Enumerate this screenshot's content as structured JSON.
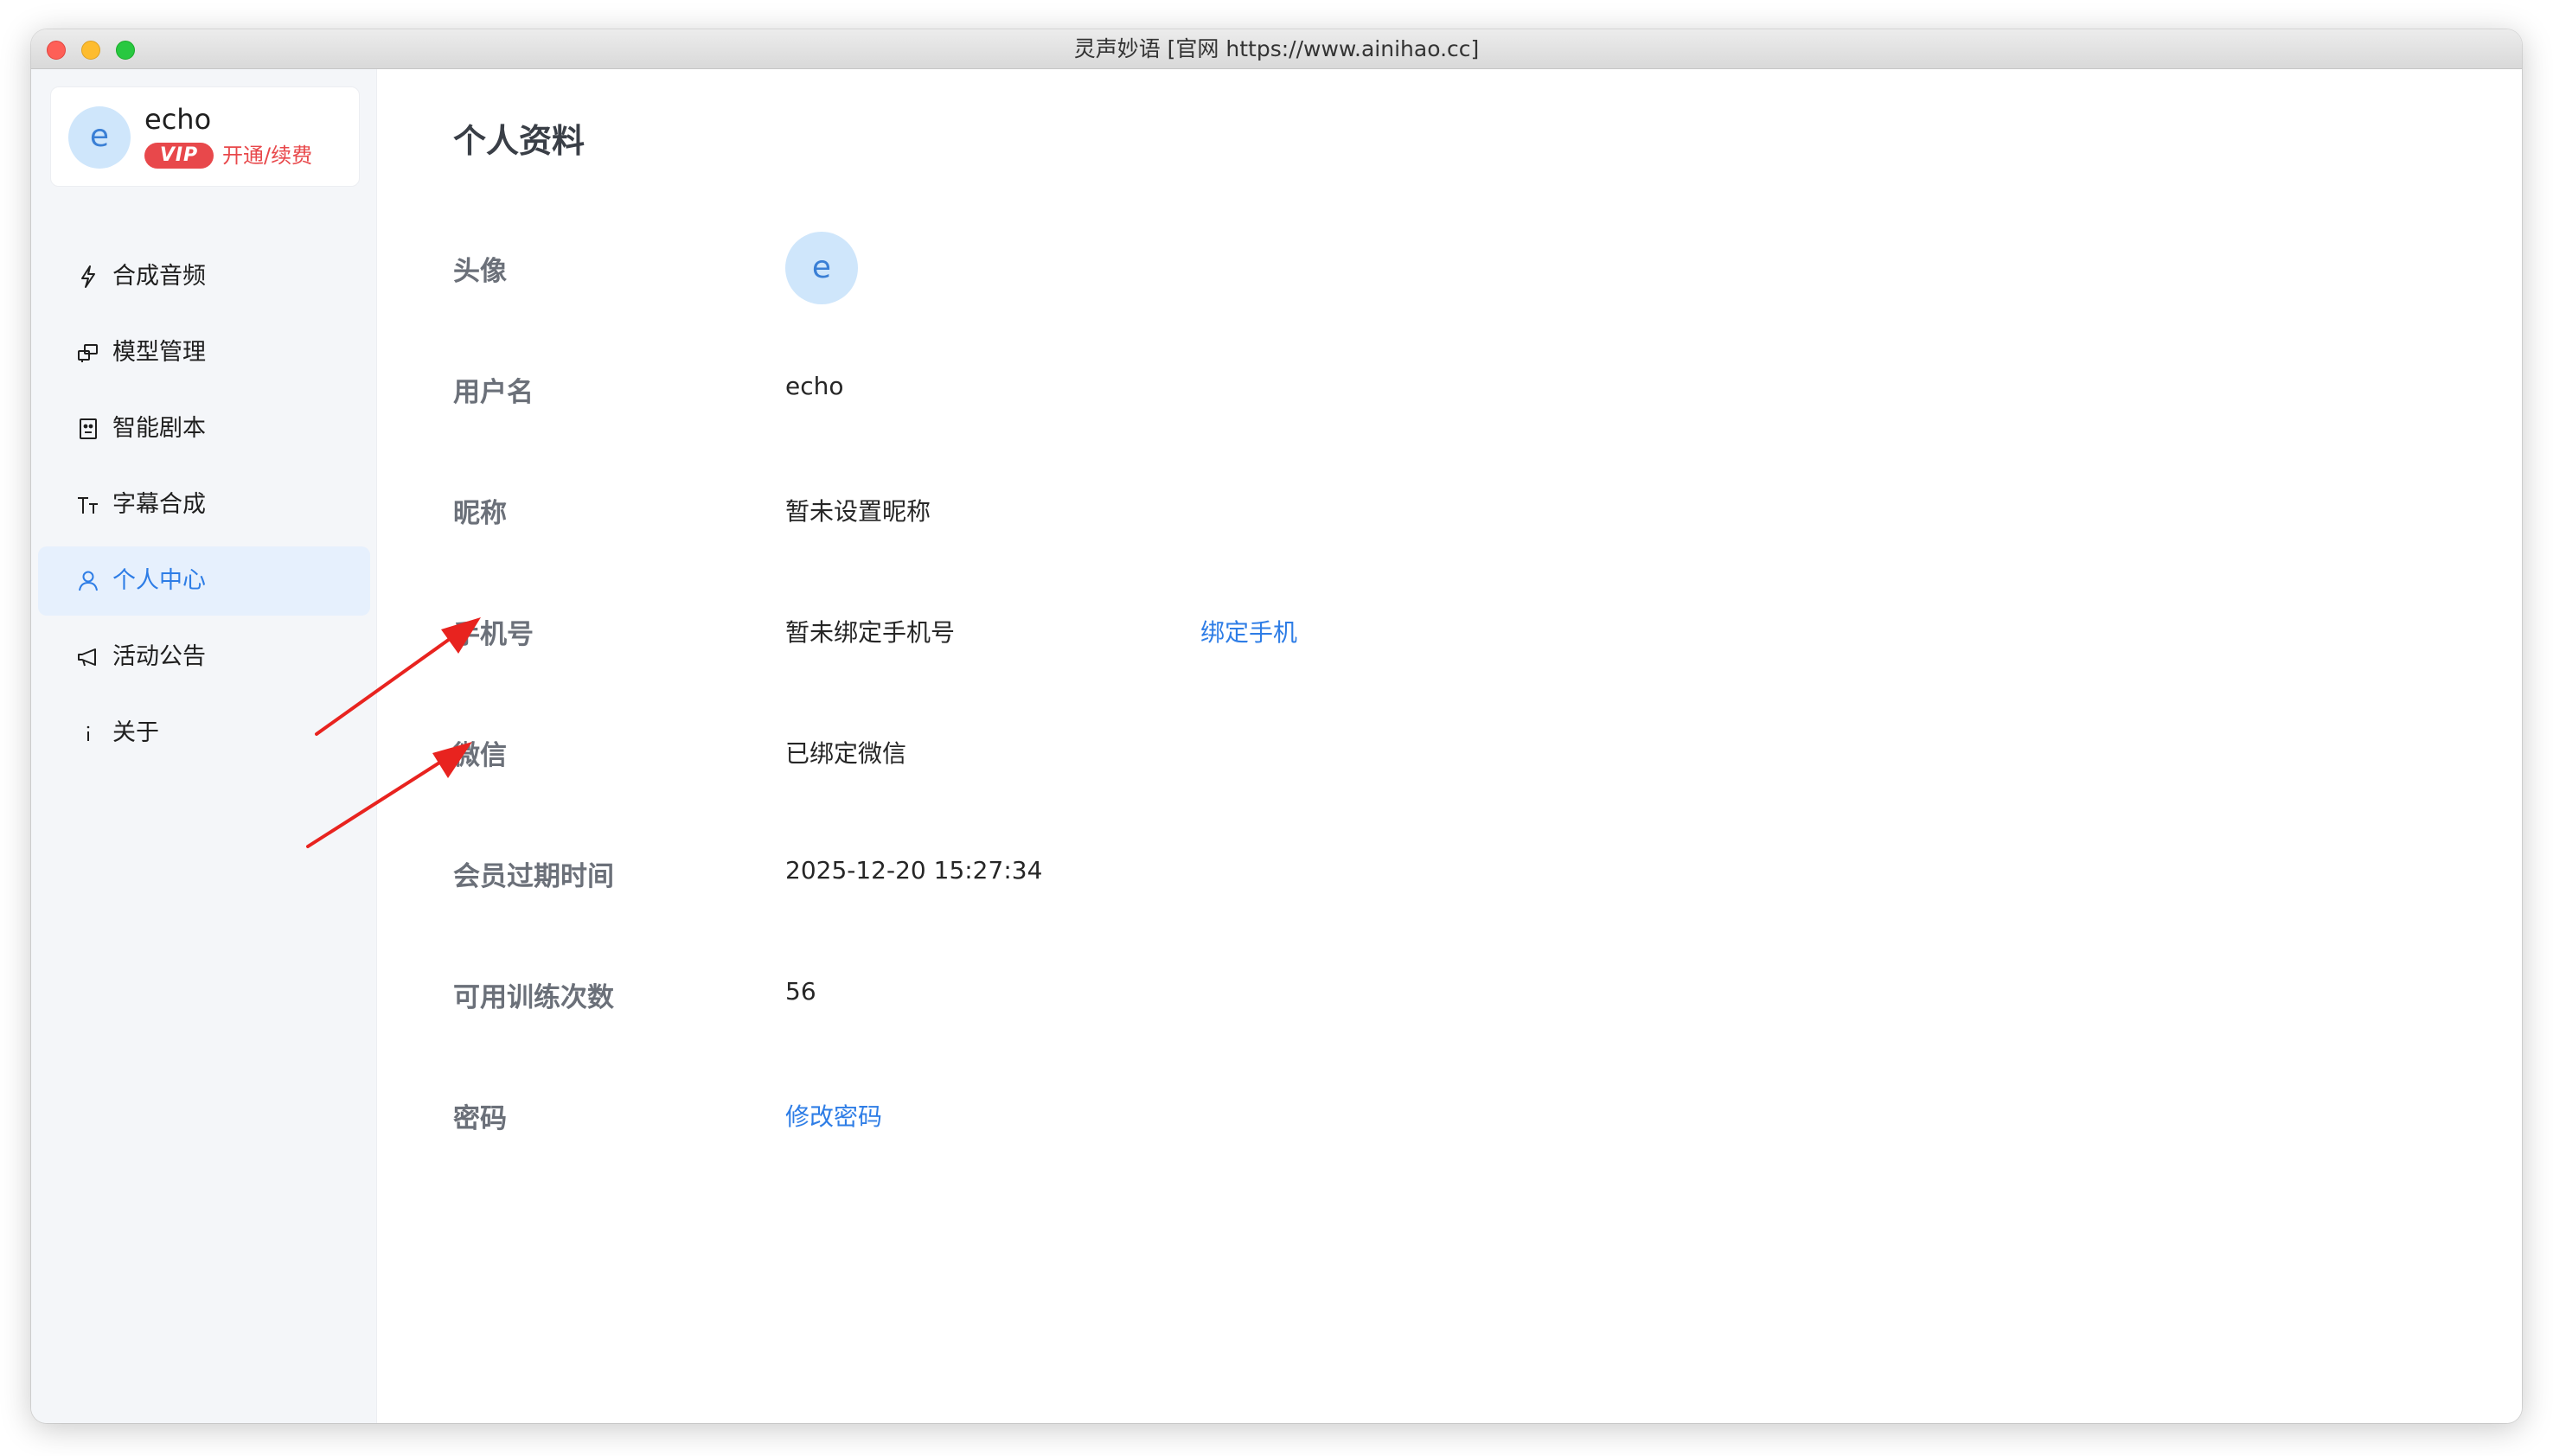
{
  "window": {
    "title": "灵声妙语 [官网 https://www.ainihao.cc]"
  },
  "sidebar": {
    "user": {
      "avatar_letter": "e",
      "username": "echo",
      "vip_label": "VIP",
      "renew_label": "开通/续费"
    },
    "items": [
      {
        "label": "合成音频",
        "icon": "lightning-icon",
        "active": false
      },
      {
        "label": "模型管理",
        "icon": "model-icon",
        "active": false
      },
      {
        "label": "智能剧本",
        "icon": "script-icon",
        "active": false
      },
      {
        "label": "字幕合成",
        "icon": "text-icon",
        "active": false
      },
      {
        "label": "个人中心",
        "icon": "user-icon",
        "active": true
      },
      {
        "label": "活动公告",
        "icon": "megaphone-icon",
        "active": false
      },
      {
        "label": "关于",
        "icon": "info-icon",
        "active": false
      }
    ]
  },
  "profile": {
    "title": "个人资料",
    "avatar": {
      "label": "头像",
      "letter": "e"
    },
    "username": {
      "label": "用户名",
      "value": "echo"
    },
    "nickname": {
      "label": "昵称",
      "value": "暂未设置昵称"
    },
    "phone": {
      "label": "手机号",
      "value": "暂未绑定手机号",
      "action": "绑定手机"
    },
    "wechat": {
      "label": "微信",
      "value": "已绑定微信"
    },
    "membership_expiry": {
      "label": "会员过期时间",
      "value": "2025-12-20 15:27:34"
    },
    "training_count": {
      "label": "可用训练次数",
      "value": "56"
    },
    "password": {
      "label": "密码",
      "action": "修改密码"
    }
  },
  "colors": {
    "accent": "#2e7de6",
    "vip": "#e8484b",
    "annotation": "#e8231f"
  }
}
